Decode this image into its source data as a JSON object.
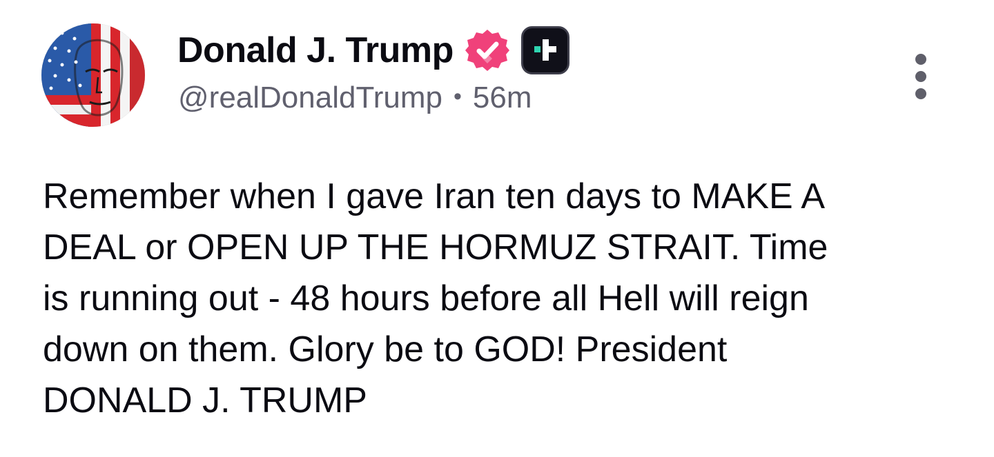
{
  "author": {
    "display_name": "Donald J. Trump",
    "handle": "@realDonaldTrump",
    "separator": "•",
    "time_ago": "56m",
    "avatar_icon": "flag-face-avatar",
    "verified_icon": "verified-badge-icon",
    "plus_icon": "plus-badge-icon"
  },
  "post": {
    "text": "Remember when I gave Iran ten days to MAKE A\nDEAL or OPEN UP THE HORMUZ STRAIT. Time\nis running out - 48 hours before all Hell will reign\ndown on them. Glory be to GOD! President\nDONALD J. TRUMP"
  },
  "menu": {
    "icon": "more-vertical-icon"
  },
  "colors": {
    "verified": "#f0417a",
    "plus_badge_bg": "#101019",
    "plus_mark": "#2fd4b0",
    "handle_text": "#60606e",
    "body_text": "#0b0b12"
  }
}
